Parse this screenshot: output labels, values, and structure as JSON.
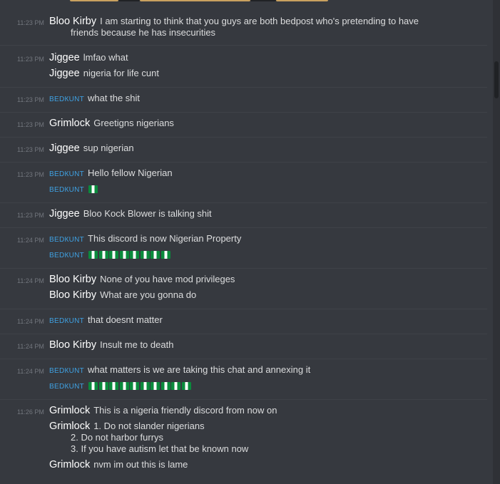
{
  "messages": [
    {
      "time": "11:23 PM",
      "lines": [
        {
          "author": "Bloo Kirby",
          "color": "#ffffff",
          "text": "I am starting to think that you guys are both bedpost who's pretending to have",
          "cont": "friends because he has insecurities"
        }
      ]
    },
    {
      "time": "11:23 PM",
      "lines": [
        {
          "author": "Jiggee",
          "color": "#ffffff",
          "text": "lmfao what"
        },
        {
          "author": "Jiggee",
          "color": "#ffffff",
          "text": "nigeria for life cunt"
        }
      ]
    },
    {
      "time": "11:23 PM",
      "lines": [
        {
          "author": "вedкunт",
          "color": "#3fa1e2",
          "text": "what the shit"
        }
      ]
    },
    {
      "time": "11:23 PM",
      "lines": [
        {
          "author": "Grimlock",
          "color": "#ffffff",
          "text": "Greetigns nigerians"
        }
      ]
    },
    {
      "time": "11:23 PM",
      "lines": [
        {
          "author": "Jiggee",
          "color": "#ffffff",
          "text": "sup nigerian"
        }
      ]
    },
    {
      "time": "11:23 PM",
      "lines": [
        {
          "author": "вedкunт",
          "color": "#3fa1e2",
          "text": "Hello fellow Nigerian"
        },
        {
          "author": "вedкunт",
          "color": "#3fa1e2",
          "text": "",
          "flags": 1
        }
      ]
    },
    {
      "time": "11:23 PM",
      "lines": [
        {
          "author": "Jiggee",
          "color": "#ffffff",
          "text": "Bloo Kock Blower is talking shit"
        }
      ]
    },
    {
      "time": "11:24 PM",
      "lines": [
        {
          "author": "вedкunт",
          "color": "#3fa1e2",
          "text": "This discord is now Nigerian Property"
        },
        {
          "author": "вedкunт",
          "color": "#3fa1e2",
          "text": "",
          "flags": 8
        }
      ]
    },
    {
      "time": "11:24 PM",
      "lines": [
        {
          "author": "Bloo Kirby",
          "color": "#ffffff",
          "text": "None of you have mod privileges"
        },
        {
          "author": "Bloo Kirby",
          "color": "#ffffff",
          "text": "What are you gonna do"
        }
      ]
    },
    {
      "time": "11:24 PM",
      "lines": [
        {
          "author": "вedкunт",
          "color": "#3fa1e2",
          "text": "that doesnt matter"
        }
      ]
    },
    {
      "time": "11:24 PM",
      "lines": [
        {
          "author": "Bloo Kirby",
          "color": "#ffffff",
          "text": "Insult me to death"
        }
      ]
    },
    {
      "time": "11:24 PM",
      "lines": [
        {
          "author": "вedкunт",
          "color": "#3fa1e2",
          "text": "what matters is we are taking this chat and annexing it"
        },
        {
          "author": "вedкunт",
          "color": "#3fa1e2",
          "text": "",
          "flags": 10
        }
      ]
    },
    {
      "time": "11:26 PM",
      "lines": [
        {
          "author": "Grimlock",
          "color": "#ffffff",
          "text": "This is a nigeria friendly discord from now on"
        },
        {
          "author": "Grimlock",
          "color": "#ffffff",
          "text": "1. Do not slander nigerians",
          "cont_lines": [
            "2. Do not harbor furrys",
            "3. If you have autism let that be known now"
          ]
        },
        {
          "author": "Grimlock",
          "color": "#ffffff",
          "text": "nvm im out this is lame"
        }
      ]
    }
  ],
  "flag_icon": "nigeria-flag-emoji",
  "colors": {
    "background": "#36393f",
    "username_default": "#ffffff",
    "username_role": "#3fa1e2",
    "timestamp": "#72767d",
    "message_text": "#dcddde"
  }
}
